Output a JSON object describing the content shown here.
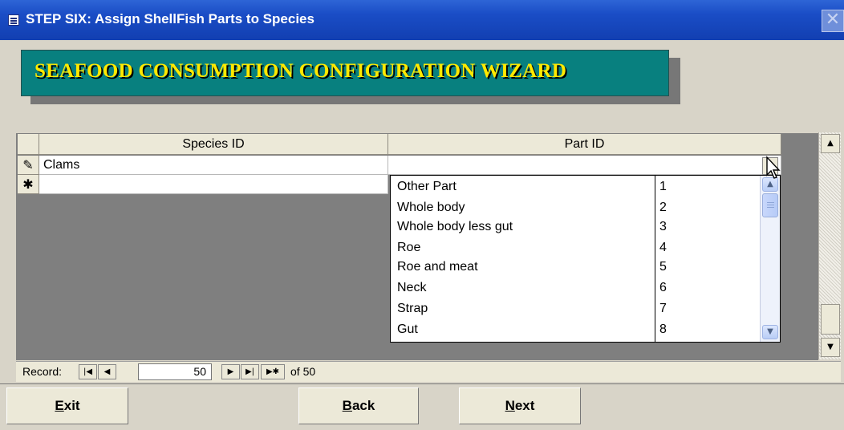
{
  "window": {
    "title": "STEP SIX:  Assign ShellFish Parts to Species",
    "close_glyph": "✕"
  },
  "banner": {
    "text": "SEAFOOD CONSUMPTION CONFIGURATION WIZARD"
  },
  "datasheet": {
    "columns": [
      "Species ID",
      "Part ID"
    ],
    "rows": [
      {
        "selector": "✎",
        "species": "Clams",
        "part": ""
      },
      {
        "selector": "✱",
        "species": "",
        "part": ""
      }
    ]
  },
  "dropdown": {
    "items": [
      {
        "name": "Other Part",
        "id": "1"
      },
      {
        "name": "Whole body",
        "id": "2"
      },
      {
        "name": "Whole body less gut",
        "id": "3"
      },
      {
        "name": "Roe",
        "id": "4"
      },
      {
        "name": "Roe and meat",
        "id": "5"
      },
      {
        "name": "Neck",
        "id": "6"
      },
      {
        "name": "Strap",
        "id": "7"
      },
      {
        "name": "Gut",
        "id": "8"
      }
    ]
  },
  "navigation": {
    "record_label": "Record:",
    "current_record": "50",
    "of_label": "of 50",
    "buttons": {
      "first": "|◀",
      "prev": "◀",
      "next": "▶",
      "last": "▶|",
      "new": "▶✱"
    }
  },
  "buttons": {
    "exit": {
      "first": "E",
      "rest": "xit"
    },
    "back": {
      "first": "B",
      "rest": "ack"
    },
    "next": {
      "first": "N",
      "rest": "ext"
    }
  }
}
